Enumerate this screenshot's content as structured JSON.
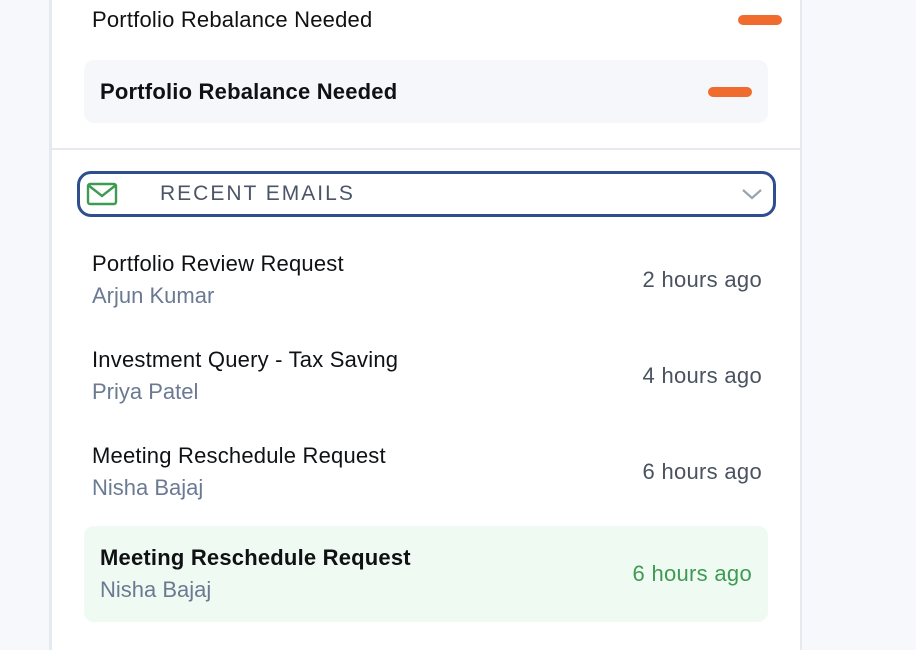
{
  "alerts": [
    {
      "title": "Portfolio Rebalance Needed",
      "badge_color": "#ef6c2e"
    },
    {
      "title": "Portfolio Rebalance Needed",
      "badge_color": "#ef6c2e"
    }
  ],
  "recent_emails": {
    "title": "RECENT EMAILS",
    "icon": "mail-icon",
    "toggle_icon": "chevron-down-icon",
    "items": [
      {
        "subject": "Portfolio Review Request",
        "sender": "Arjun Kumar",
        "time": "2 hours ago"
      },
      {
        "subject": "Investment Query - Tax Saving",
        "sender": "Priya Patel",
        "time": "4 hours ago"
      },
      {
        "subject": "Meeting Reschedule Request",
        "sender": "Nisha Bajaj",
        "time": "6 hours ago"
      },
      {
        "subject": "Meeting Reschedule Request",
        "sender": "Nisha Bajaj",
        "time": "6 hours ago"
      }
    ]
  },
  "colors": {
    "accent_orange": "#ef6c2e",
    "header_border": "#2f4e8f",
    "mail_icon_green": "#3f9a52",
    "highlight_green_bg": "#effaf2"
  }
}
